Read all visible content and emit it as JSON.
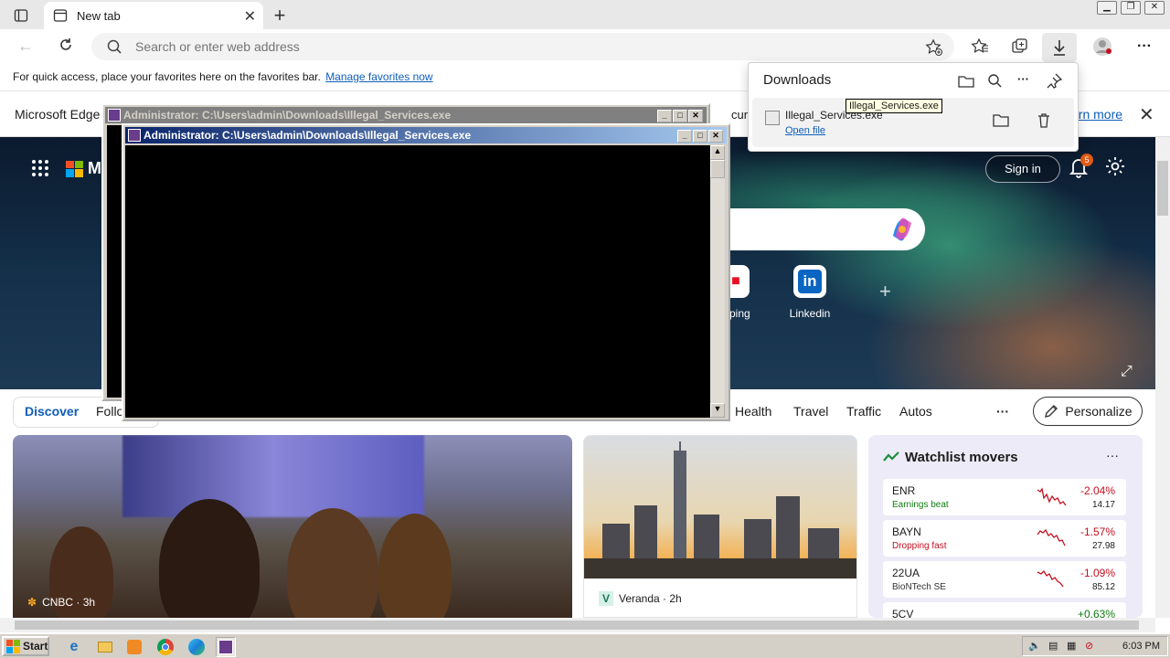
{
  "browser": {
    "tab_title": "New tab",
    "address_placeholder": "Search or enter web address",
    "favbar_text": "For quick access, place your favorites here on the favorites bar.",
    "favbar_link": "Manage favorites now",
    "infobar_text": "Microsoft Edge",
    "infobar_tail": "curity u",
    "infobar_link": "arn more"
  },
  "downloads": {
    "title": "Downloads",
    "file_name": "Illegal_Services.exe",
    "open_link": "Open file",
    "tooltip": "Illegal_Services.exe"
  },
  "newtab": {
    "brand_partial": "M",
    "signin": "Sign in",
    "notif_count": "5",
    "tiles": [
      {
        "label": "pping"
      },
      {
        "label": "Linkedin"
      }
    ],
    "feed_tabs": [
      "Discover",
      "Follo",
      "Health",
      "Travel",
      "Traffic",
      "Autos"
    ],
    "more": "···",
    "personalize": "Personalize",
    "card_main_source": "CNBC · 3h",
    "card_city_source": "Veranda · 2h",
    "watchlist": {
      "title": "Watchlist movers",
      "stocks": [
        {
          "symbol": "ENR",
          "note": "Earnings beat",
          "note_color": "#107c10",
          "change": "-2.04%",
          "price": "14.17"
        },
        {
          "symbol": "BAYN",
          "note": "Dropping fast",
          "note_color": "#c50f1f",
          "change": "-1.57%",
          "price": "27.98"
        },
        {
          "symbol": "22UA",
          "note": "BioNTech SE",
          "note_color": "#333333",
          "change": "-1.09%",
          "price": "85.12"
        },
        {
          "symbol": "5CV",
          "note": "",
          "note_color": "#333333",
          "change": "+0.63%",
          "price": ""
        }
      ]
    }
  },
  "consoles": {
    "back_title": "Administrator: C:\\Users\\admin\\Downloads\\Illegal_Services.exe",
    "front_title": "Administrator: C:\\Users\\admin\\Downloads\\Illegal_Services.exe"
  },
  "taskbar": {
    "start": "Start",
    "clock": "6:03 PM"
  },
  "colors": {
    "accent": "#0f5dbb",
    "console_title_active": "#0a246a",
    "console_title_inactive": "#808080"
  }
}
